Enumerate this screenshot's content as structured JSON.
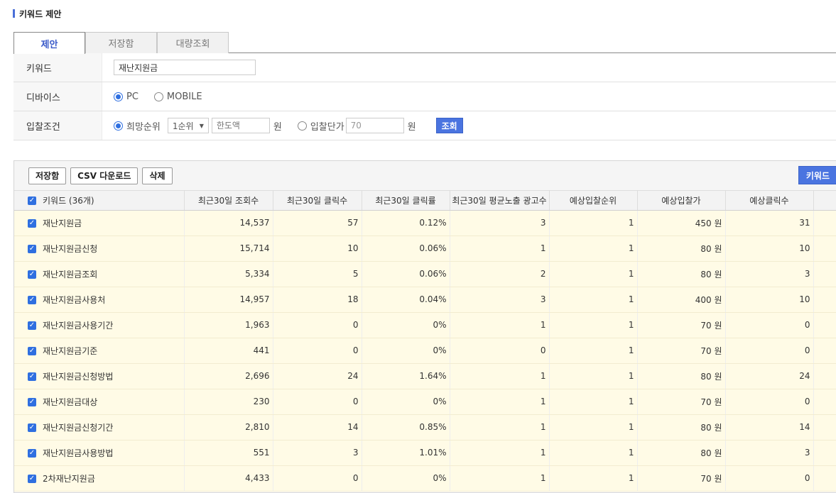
{
  "title": "키워드 제안",
  "tabs": [
    {
      "label": "제안",
      "active": true
    },
    {
      "label": "저장함",
      "active": false
    },
    {
      "label": "대량조회",
      "active": false
    }
  ],
  "form": {
    "keyword_label": "키워드",
    "keyword_value": "재난지원금",
    "device_label": "디바이스",
    "device_options": [
      "PC",
      "MOBILE"
    ],
    "device_selected": "PC",
    "bid_label": "입찰조건",
    "bid_option_rank": "희망순위",
    "rank_select": "1순위",
    "limit_placeholder": "한도액",
    "won1": "원",
    "bid_option_unit": "입찰단가",
    "unit_value": "70",
    "won2": "원",
    "search_button": "조회"
  },
  "toolbar": {
    "save": "저장함",
    "csv": "CSV 다운로드",
    "delete": "삭제",
    "keyword": "키워드"
  },
  "table": {
    "headers": [
      "키워드 (36개)",
      "최근30일 조회수",
      "최근30일 클릭수",
      "최근30일 클릭률",
      "최근30일 평균노출 광고수",
      "예상입찰순위",
      "예상입찰가",
      "예상클릭수"
    ],
    "rows": [
      [
        "재난지원금",
        "14,537",
        "57",
        "0.12%",
        "3",
        "1",
        "450 원",
        "31"
      ],
      [
        "재난지원금신청",
        "15,714",
        "10",
        "0.06%",
        "1",
        "1",
        "80 원",
        "10"
      ],
      [
        "재난지원금조회",
        "5,334",
        "5",
        "0.06%",
        "2",
        "1",
        "80 원",
        "3"
      ],
      [
        "재난지원금사용처",
        "14,957",
        "18",
        "0.04%",
        "3",
        "1",
        "400 원",
        "10"
      ],
      [
        "재난지원금사용기간",
        "1,963",
        "0",
        "0%",
        "1",
        "1",
        "70 원",
        "0"
      ],
      [
        "재난지원금기준",
        "441",
        "0",
        "0%",
        "0",
        "1",
        "70 원",
        "0"
      ],
      [
        "재난지원금신청방법",
        "2,696",
        "24",
        "1.64%",
        "1",
        "1",
        "80 원",
        "24"
      ],
      [
        "재난지원금대상",
        "230",
        "0",
        "0%",
        "1",
        "1",
        "70 원",
        "0"
      ],
      [
        "재난지원금신청기간",
        "2,810",
        "14",
        "0.85%",
        "1",
        "1",
        "80 원",
        "14"
      ],
      [
        "재난지원금사용방법",
        "551",
        "3",
        "1.01%",
        "1",
        "1",
        "80 원",
        "3"
      ],
      [
        "2차재난지원금",
        "4,433",
        "0",
        "0%",
        "1",
        "1",
        "70 원",
        "0"
      ]
    ]
  },
  "colors": {
    "accent": "#4a74e0",
    "row_bg": "#fffbe6",
    "header_bg": "#f3f3f3"
  }
}
